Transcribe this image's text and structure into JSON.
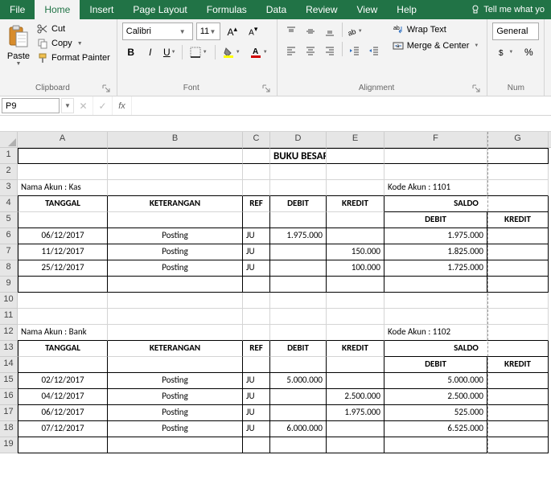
{
  "tabs": {
    "file": "File",
    "home": "Home",
    "insert": "Insert",
    "pageLayout": "Page Layout",
    "formulas": "Formulas",
    "data": "Data",
    "review": "Review",
    "view": "View",
    "help": "Help",
    "tellMe": "Tell me what yo"
  },
  "ribbon": {
    "clipboard": {
      "paste": "Paste",
      "cut": "Cut",
      "copy": "Copy",
      "formatPainter": "Format Painter",
      "label": "Clipboard"
    },
    "font": {
      "name": "Calibri",
      "size": "11",
      "label": "Font"
    },
    "alignment": {
      "wrapText": "Wrap Text",
      "mergeCenter": "Merge & Center",
      "label": "Alignment"
    },
    "number": {
      "format": "General",
      "label": "Num"
    }
  },
  "nameBox": "P9",
  "sheet": {
    "title": "BUKU BESAR",
    "acct1Label": "Nama Akun : Kas",
    "acct1Code": "Kode Akun : 1101",
    "acct2Label": "Nama Akun : Bank",
    "acct2Code": "Kode Akun : 1102",
    "headers": {
      "tanggal": "TANGGAL",
      "keterangan": "KETERANGAN",
      "ref": "REF",
      "debit": "DEBIT",
      "kredit": "KREDIT",
      "saldo": "SALDO"
    },
    "rows1": [
      {
        "t": "06/12/2017",
        "k": "Posting",
        "r": "JU",
        "d": "1.975.000",
        "c": "",
        "sd": "1.975.000"
      },
      {
        "t": "11/12/2017",
        "k": "Posting",
        "r": "JU",
        "d": "",
        "c": "150.000",
        "sd": "1.825.000"
      },
      {
        "t": "25/12/2017",
        "k": "Posting",
        "r": "JU",
        "d": "",
        "c": "100.000",
        "sd": "1.725.000"
      }
    ],
    "rows2": [
      {
        "t": "02/12/2017",
        "k": "Posting",
        "r": "JU",
        "d": "5.000.000",
        "c": "",
        "sd": "5.000.000"
      },
      {
        "t": "04/12/2017",
        "k": "Posting",
        "r": "JU",
        "d": "",
        "c": "2.500.000",
        "sd": "2.500.000"
      },
      {
        "t": "06/12/2017",
        "k": "Posting",
        "r": "JU",
        "d": "",
        "c": "1.975.000",
        "sd": "525.000"
      },
      {
        "t": "07/12/2017",
        "k": "Posting",
        "r": "JU",
        "d": "6.000.000",
        "c": "",
        "sd": "6.525.000"
      }
    ]
  }
}
